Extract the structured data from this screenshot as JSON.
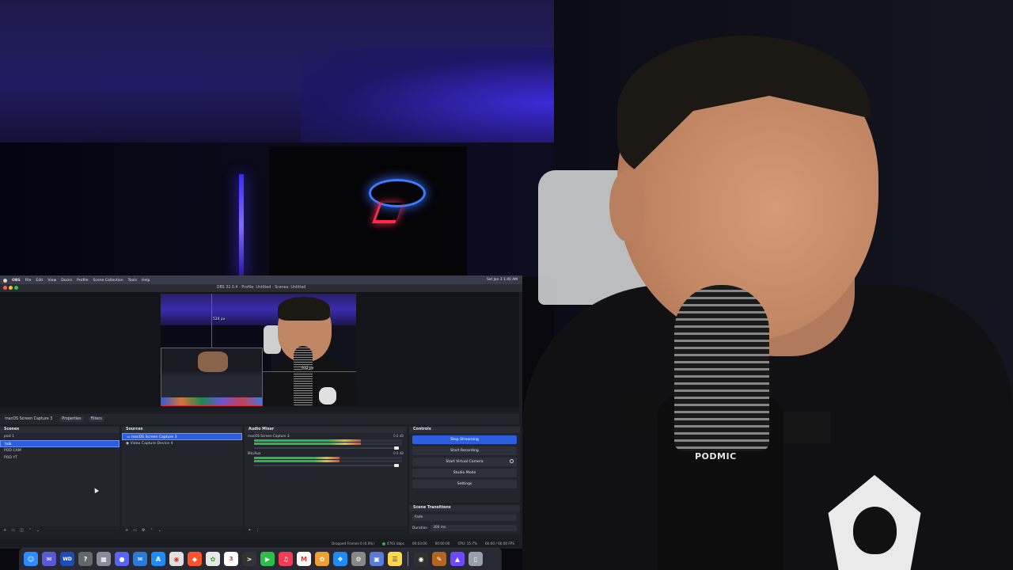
{
  "menubar": {
    "app": "OBS",
    "items": [
      "File",
      "Edit",
      "View",
      "Docks",
      "Profile",
      "Scene Collection",
      "Tools",
      "Help"
    ],
    "clock": "Sat Jan 3  1:40 AM"
  },
  "window": {
    "title": "OBS 32.0.4 - Profile: Untitled - Scenes: Untitled"
  },
  "preview": {
    "label_top": "524 px",
    "label_mid": "932 px"
  },
  "source_bar": {
    "selected_source": "macOS Screen Capture 3",
    "properties": "Properties",
    "filters": "Filters"
  },
  "scenes": {
    "header": "Scenes",
    "items": [
      "pod 1",
      "talk",
      "POD CAM",
      "POD YT"
    ],
    "selected_index": 1
  },
  "sources": {
    "header": "Sources",
    "items": [
      "macOS Screen Capture 3",
      "Video Capture Device 4"
    ],
    "selected_index": 0
  },
  "audio_mixer": {
    "header": "Audio Mixer",
    "channels": [
      {
        "name": "macOS Screen Capture 3",
        "db": "0.0 dB",
        "level": 0.72
      },
      {
        "name": "Mic/Aux",
        "db": "0.0 dB",
        "level": 0.58
      }
    ]
  },
  "controls": {
    "header": "Controls",
    "buttons": [
      "Stop Streaming",
      "Start Recording",
      "Start Virtual Camera",
      "Studio Mode",
      "Settings"
    ],
    "active_index": 0
  },
  "scene_transitions": {
    "header": "Scene Transitions",
    "transition": "Fade",
    "duration_label": "Duration",
    "duration_value": "300 ms"
  },
  "status": {
    "dropped": "Dropped Frames 0 (0.0%)",
    "bitrate": "4761 kbps",
    "stream_time": "00:03:06",
    "rec_time": "00:00:00",
    "cpu": "CPU: 15.7%",
    "fps": "60.00 / 60.00 FPS"
  },
  "overlay": {
    "brand": "PODMIC"
  },
  "dock_icons": [
    "finder-icon",
    "mail-icon",
    "wd-icon",
    "help-icon",
    "launchpad-icon",
    "discord-icon",
    "mailbox-icon",
    "appstore-icon",
    "chrome-icon",
    "brave-icon",
    "photos-icon",
    "calendar-icon",
    "terminal-icon",
    "facetime-icon",
    "music-icon",
    "gmail-icon",
    "photos2-icon",
    "safari-icon",
    "settings-icon",
    "preview-icon",
    "notes-icon",
    "obs-icon",
    "brush-icon",
    "proton-icon",
    "trash-icon"
  ],
  "colors": {
    "accent": "#2d5ee0",
    "selection_border": "#e8293a",
    "panel_bg": "#23242c"
  }
}
